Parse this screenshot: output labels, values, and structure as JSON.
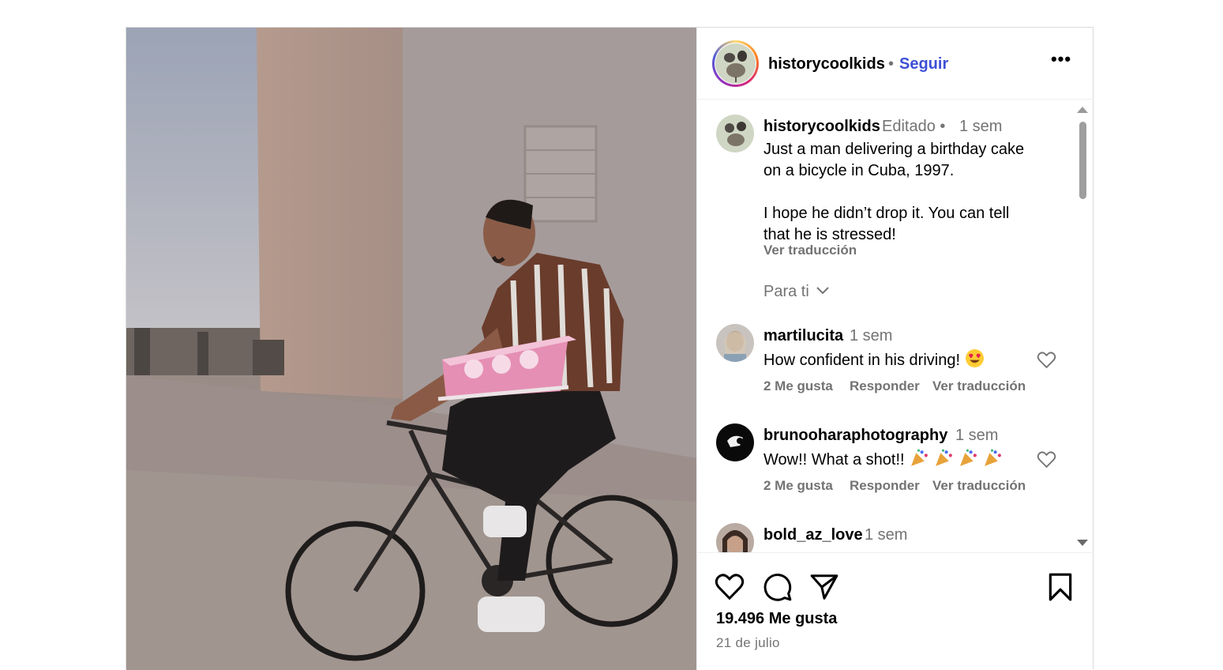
{
  "post": {
    "author": "historycoolkids",
    "separator": "•",
    "follow_label": "Seguir",
    "more_label": "•••"
  },
  "caption": {
    "username": "historycoolkids",
    "edited": "Editado •",
    "time": "1 sem",
    "text": "Just a man delivering a birthday cake\non a bicycle in Cuba, 1997.\n\nI hope he didn’t drop it. You can tell\nthat he is stressed!",
    "translation": "Ver traducción"
  },
  "filter": {
    "label": "Para ti"
  },
  "comments": [
    {
      "username": "martilucita",
      "time": "1 sem",
      "text": "How confident in his driving!",
      "emoji": "heart-eyes-emoji",
      "likes": "2 Me gusta",
      "reply": "Responder",
      "translation": "Ver traducción"
    },
    {
      "username": "brunooharaphotography",
      "time": "1 sem",
      "text": "Wow!! What a shot!!",
      "emoji": "party-popper-emoji",
      "likes": "2 Me gusta",
      "reply": "Responder",
      "translation": "Ver traducción"
    },
    {
      "username": "bold_az_love",
      "time": "1 sem"
    }
  ],
  "footer": {
    "likes": "19.496 Me gusta",
    "date": "21 de julio"
  },
  "colors": {
    "follow": "#3d50d6",
    "muted": "#737373",
    "border": "#dbdbdb"
  }
}
